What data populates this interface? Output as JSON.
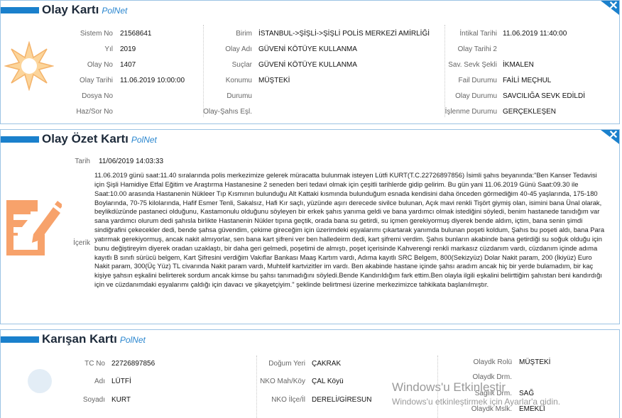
{
  "olay": {
    "title": "Olay Kartı",
    "brand": "PolNet",
    "close": "✕",
    "col1": [
      {
        "label": "Sistem No",
        "value": "21568641"
      },
      {
        "label": "Yıl",
        "value": "2019"
      },
      {
        "label": "Olay No",
        "value": "1407"
      },
      {
        "label": "Olay Tarihi",
        "value": "11.06.2019 10:00:00"
      },
      {
        "label": "Dosya No",
        "value": ""
      },
      {
        "label": "Haz/Sor No",
        "value": ""
      }
    ],
    "col2": [
      {
        "label": "Birim",
        "value": "İSTANBUL->ŞİŞLİ->ŞİŞLİ POLİS MERKEZİ AMİRLİĞİ"
      },
      {
        "label": "Olay Adı",
        "value": "GÜVENİ KÖTÜYE KULLANMA"
      },
      {
        "label": "Suçlar",
        "value": "GÜVENİ KÖTÜYE KULLANMA"
      },
      {
        "label": "Konumu",
        "value": "MÜŞTEKİ"
      },
      {
        "label": "Durumu",
        "value": ""
      },
      {
        "label": "Olay-Şahıs Eşl.",
        "value": ""
      }
    ],
    "col3": [
      {
        "label": "İntikal Tarihi",
        "value": "11.06.2019 11:40:00"
      },
      {
        "label": "Olay Tarihi 2",
        "value": ""
      },
      {
        "label": "Sav. Sevk Şekli",
        "value": "İKMALEN"
      },
      {
        "label": "Fail Durumu",
        "value": "FAİLİ MEÇHUL"
      },
      {
        "label": "Olay Durumu",
        "value": "SAVCILIĞA SEVK EDİLDİ"
      },
      {
        "label": "İşlenme Durumu",
        "value": "GERÇEKLEŞEN"
      }
    ]
  },
  "ozet": {
    "title": "Olay Özet Kartı",
    "brand": "PolNet",
    "close": "✕",
    "date_label": "Tarih",
    "date_value": "11/06/2019 14:03:33",
    "content_label": "İçerik",
    "content": "11.06.2019 günü saat:11.40 sıralarında polis merkezimize gelerek müracatta bulunmak isteyen Lütfi KURT(T.C.22726897856) İsimli şahıs beyanında:\"Ben Kanser Tedavisi için Şişli Hamidiye Etfal Eğitim ve Araştırma Hastanesine 2 seneden beri tedavi olmak için çeşitli tarihlerde gidip gelirim. Bu gün yani 11.06.2019 Günü Saat:09.30 ile Saat:10.00 arasında Hastanenin Nükleer Tıp Kısmının bulunduğu Alt Kattaki kısmında bulunduğum esnada kendisini daha önceden görmediğim 40-45 yaşlarında, 175-180 Boylarında, 70-75 kilolarında, Hafif Esmer Tenli, Sakalsız, Hafi Kır saçlı, yüzünde aşırı derecede sivilce bulunan, Açık mavi renkli Tişört giymiş olan, isimini bana Ünal olarak, beylikdüzünde pastaneci olduğunu, Kastamonulu olduğunu söyleyen bir erkek şahıs yanıma geldi ve bana yardımcı olmak istediğini söyledi, benim hastanede tanıdığım var sana yardımcı olurum dedi şahısla birlikte Hastanenin Nükler tıpına geçtik, orada bana su getirdi, su içmen gerekiyormuş diyerek bende aldım, içtim, bana senin şimdi sindiğrafini çekecekler dedi, bende şahsa güvendim, çekime gireceğim için üzerimdeki eşyalarımı çıkartarak yanımda bulunan poşeti koldum, Şahıs bu poşeti aldı, bana Para yatırmak gerekiyormuş, ancak nakit almıyorlar, sen bana kart şifreni ver ben halledeirm dedi, kart şifremi verdim. Şahıs bunların akabinde bana getirdiği su soğuk olduğu için bunu değiştireyim diyerek oradan uzaklaştı, bir daha geri gelmedi, poşetimi de almıştı, poşet içerisinde Kahverengi renkli markasız cüzdanım vardı, cüzdanım içinde adıma kayıtlı B sınıfı sürücü belgem, Kart Şifresini verdiğim Vakıflar Bankası Maaş Kartım vardı, Adıma kayıtlı SRC Belgem, 800(Sekizyüz) Dolar Nakit param, 200 (İkiyüz) Euro Nakit param, 300(Üç Yüz) TL civarında Nakit param vardı, Muhtelif kartvizitler im vardı. Ben akabinde hastane içinde şahsı aradım ancak hiç bir yerde bulamadım, bir kaç kişiye şahsın eşkalini belirterek sordum ancak kimse bu şahsı tanımadığını söyledi.Bende Kandırıldığım fark ettim.Ben olayla ilgili eşkalini belirttiğim şahıstan beni kandırdığı için ve cüzdanımdaki eşyalarımı çaldığı için davacı ve şikayetçiyim.\" şeklinde belirtmesi üzerine merkezimizce tahkikata başlanılmıştır."
  },
  "karisan": {
    "title": "Karışan Kartı",
    "brand": "PolNet",
    "col1": [
      {
        "label": "TC No",
        "value": "22726897856"
      },
      {
        "label": "Adı",
        "value": "LÜTFİ"
      },
      {
        "label": "Soyadı",
        "value": "KURT"
      }
    ],
    "col2": [
      {
        "label": "Doğum Yeri",
        "value": "ÇAKRAK"
      },
      {
        "label": "NKO Mah/Köy",
        "value": "ÇAL Köyü"
      },
      {
        "label": "NKO İlçe/İl",
        "value": "DERELİ/GİRESUN"
      }
    ],
    "col3": [
      {
        "label": "Olaydk Rolü",
        "value": "MÜŞTEKİ"
      },
      {
        "label": "Olaydk Drm.",
        "value": ""
      },
      {
        "label": "Sağlık Drm.",
        "value": "SAĞ"
      },
      {
        "label": "Olaydk Mslk.",
        "value": "EMEKLİ"
      }
    ]
  },
  "watermark": {
    "line1": "Windows'u Etkinleştir",
    "line2": "Windows'u etkinleştirmek için Ayarlar'a gidin."
  },
  "colors": {
    "accent": "#1a80cc",
    "icon_orange": "#f7a26b",
    "star_fill": "#fcd59b"
  }
}
